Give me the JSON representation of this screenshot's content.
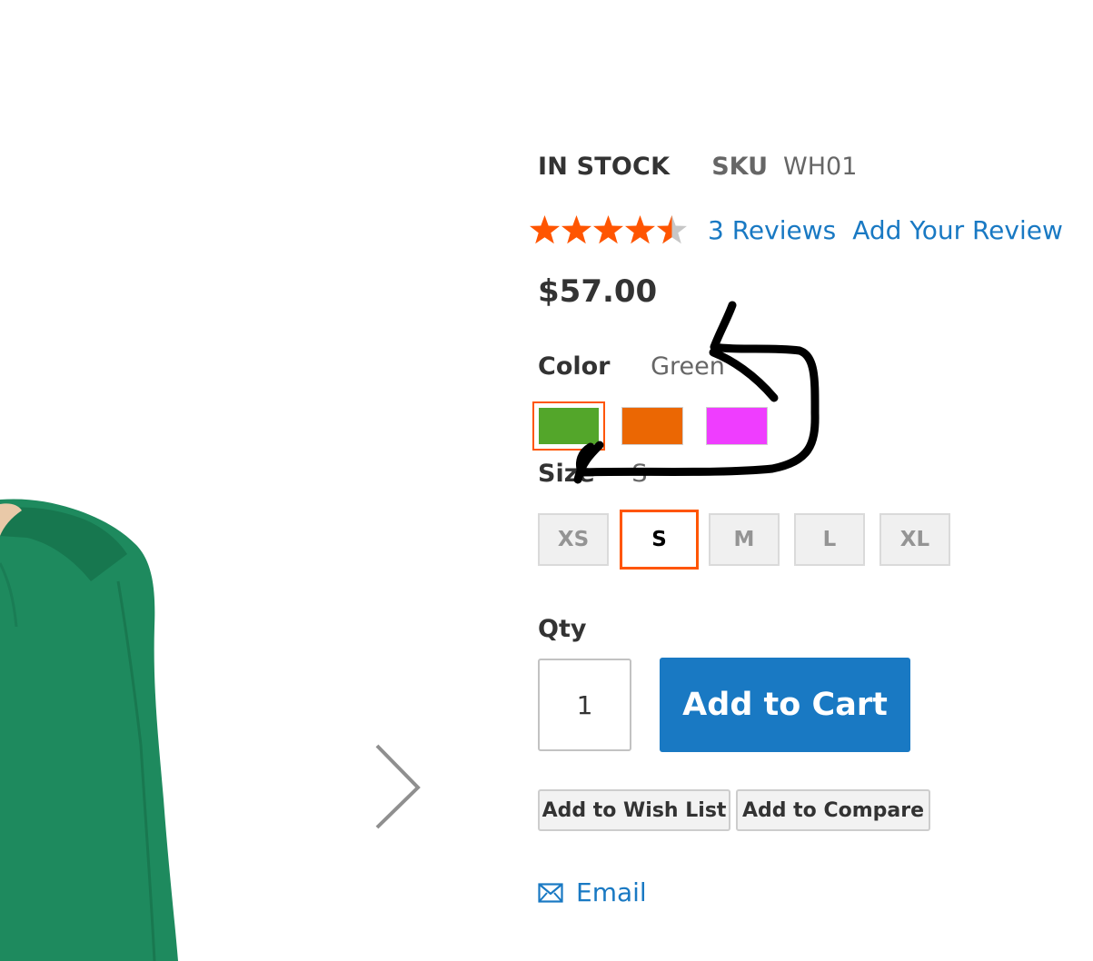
{
  "product": {
    "stock_status": "IN STOCK",
    "sku_label": "SKU",
    "sku": "WH01",
    "rating": 4.5,
    "rating_max": 5,
    "reviews_link": "3 Reviews",
    "add_review_link": "Add Your Review",
    "price": "$57.00",
    "image_alt": "Green hooded sweatshirt"
  },
  "color": {
    "label": "Color",
    "selected": "Green",
    "swatches": [
      {
        "name": "Green",
        "hex": "#53a62a"
      },
      {
        "name": "Orange",
        "hex": "#eb6703"
      },
      {
        "name": "Purple",
        "hex": "#ef3dff"
      }
    ]
  },
  "size": {
    "label": "Size",
    "selected": "S",
    "options": [
      "XS",
      "S",
      "M",
      "L",
      "XL"
    ]
  },
  "qty": {
    "label": "Qty",
    "value": "1"
  },
  "actions": {
    "add_to_cart": "Add to Cart",
    "wishlist": "Add to Wish List",
    "compare": "Add to Compare",
    "email": "Email"
  },
  "icons": {
    "rating": "star-icon",
    "next": "chevron-right-icon",
    "email": "envelope-icon"
  },
  "colors": {
    "accent": "#1979c3",
    "selected_border": "#ff5501",
    "star": "#ff5501",
    "star_empty": "#c7c7c7",
    "garment": "#1e8a5e"
  }
}
